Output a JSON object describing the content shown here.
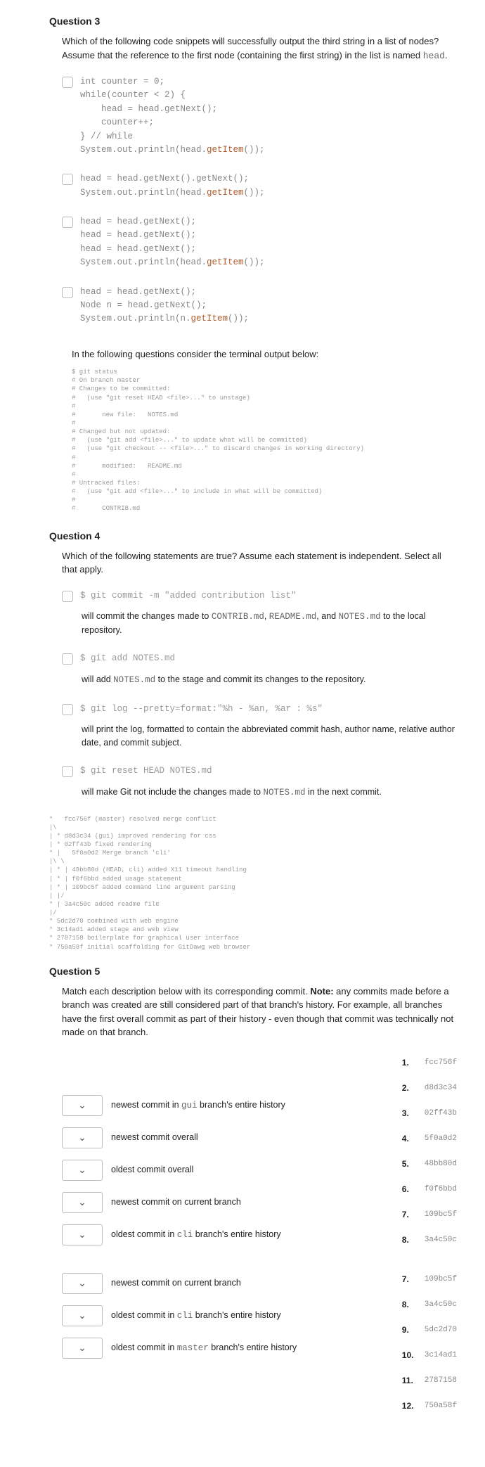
{
  "q3": {
    "title": "Question 3",
    "stem_a": "Which of the following code snippets will successfully output the third string in a list of nodes? Assume that the reference to the first node (containing the first string) in the list is named ",
    "stem_code": "head",
    "stem_b": ".",
    "opts": [
      {
        "pre": "int counter = 0;\nwhile(counter < 2) {\n    head = head.getNext();\n    counter++;\n} // while\nSystem.out.println(head.",
        "hl": "getItem",
        "post": "());"
      },
      {
        "pre": "head = head.getNext().getNext();\nSystem.out.println(head.",
        "hl": "getItem",
        "post": "());"
      },
      {
        "pre": "head = head.getNext();\nhead = head.getNext();\nhead = head.getNext();\nSystem.out.println(head.",
        "hl": "getItem",
        "post": "());"
      },
      {
        "pre": "head = head.getNext();\nNode n = head.getNext();\nSystem.out.println(n.",
        "hl": "getItem",
        "post": "());"
      }
    ]
  },
  "prompt_terminal": "In the following questions consider the terminal output below:",
  "terminal": "$ git status\n# On branch master\n# Changes to be committed:\n#   (use \"git reset HEAD <file>...\" to unstage)\n#\n#       new file:   NOTES.md\n#\n# Changed but not updated:\n#   (use \"git add <file>...\" to update what will be committed)\n#   (use \"git checkout -- <file>...\" to discard changes in working directory)\n#\n#       modified:   README.md\n#\n# Untracked files:\n#   (use \"git add <file>...\" to include in what will be committed)\n#\n#       CONTRIB.md",
  "q4": {
    "title": "Question 4",
    "stem": "Which of the following statements are true? Assume each statement is independent. Select all that apply.",
    "opts": [
      {
        "cmd": "$ git commit -m \"added contribution list\"",
        "exp_a": "will commit the changes made to ",
        "exp_codes": [
          "CONTRIB.md",
          "README.md",
          "NOTES.md"
        ],
        "exp_join1": ", ",
        "exp_join2": ", and ",
        "exp_b": " to the local repository."
      },
      {
        "cmd": "$ git add NOTES.md",
        "exp_a": "will add ",
        "exp_codes": [
          "NOTES.md"
        ],
        "exp_b": " to the stage and commit its changes to the repository."
      },
      {
        "cmd": "$ git log --pretty=format:\"%h - %an, %ar : %s\"",
        "exp_a": "will print the log, formatted to contain the abbreviated commit hash, author name, relative author date, and commit subject.",
        "exp_codes": [],
        "exp_b": ""
      },
      {
        "cmd": "$ git reset HEAD NOTES.md",
        "exp_a": "will make Git not include the changes made to ",
        "exp_codes": [
          "NOTES.md"
        ],
        "exp_b": " in the next commit."
      }
    ]
  },
  "gitgraph": "*   fcc756f (master) resolved merge conflict\n|\\\n| * d8d3c34 (gui) improved rendering for css\n| * 02ff43b fixed rendering\n* |   5f0a0d2 Merge branch 'cli'\n|\\ \\\n| * | 48bb80d (HEAD, cli) added X11 timeout handling\n| * | f0f6bbd added usage statement\n| * | 109bc5f added command line argument parsing\n| |/\n* | 3a4c50c added readme file\n|/\n* 5dc2d70 combined with web engine\n* 3c14ad1 added stage and web view\n* 2787158 boilerplate for graphical user interface\n* 750a58f initial scaffolding for GitDawg web browser",
  "q5": {
    "title": "Question 5",
    "stem_a": "Match each description below with its corresponding commit. ",
    "stem_bold": "Note:",
    "stem_b": " any commits made before a branch was created are still considered part of that branch's history. For example, all branches have the first overall commit as part of their history - even though that commit was technically not made on that branch.",
    "left_a": [
      {
        "label_a": "newest commit in ",
        "code": "gui",
        "label_b": " branch's entire history"
      },
      {
        "label_a": "newest commit overall",
        "code": "",
        "label_b": ""
      },
      {
        "label_a": "oldest commit overall",
        "code": "",
        "label_b": ""
      },
      {
        "label_a": "newest commit on current branch",
        "code": "",
        "label_b": ""
      },
      {
        "label_a": "oldest commit in ",
        "code": "cli",
        "label_b": " branch's entire history"
      }
    ],
    "right_a": [
      {
        "n": "1.",
        "h": "fcc756f"
      },
      {
        "n": "2.",
        "h": "d8d3c34"
      },
      {
        "n": "3.",
        "h": "02ff43b"
      },
      {
        "n": "4.",
        "h": "5f0a0d2"
      },
      {
        "n": "5.",
        "h": "48bb80d"
      },
      {
        "n": "6.",
        "h": "f0f6bbd"
      },
      {
        "n": "7.",
        "h": "109bc5f"
      },
      {
        "n": "8.",
        "h": "3a4c50c"
      }
    ],
    "left_b": [
      {
        "label_a": "newest commit on current branch",
        "code": "",
        "label_b": ""
      },
      {
        "label_a": "oldest commit in ",
        "code": "cli",
        "label_b": " branch's entire history"
      },
      {
        "label_a": "oldest commit in ",
        "code": "master",
        "label_b": " branch's entire history"
      }
    ],
    "right_b": [
      {
        "n": "7.",
        "h": "109bc5f"
      },
      {
        "n": "8.",
        "h": "3a4c50c"
      },
      {
        "n": "9.",
        "h": "5dc2d70"
      },
      {
        "n": "10.",
        "h": "3c14ad1"
      },
      {
        "n": "11.",
        "h": "2787158"
      },
      {
        "n": "12.",
        "h": "750a58f"
      }
    ]
  }
}
